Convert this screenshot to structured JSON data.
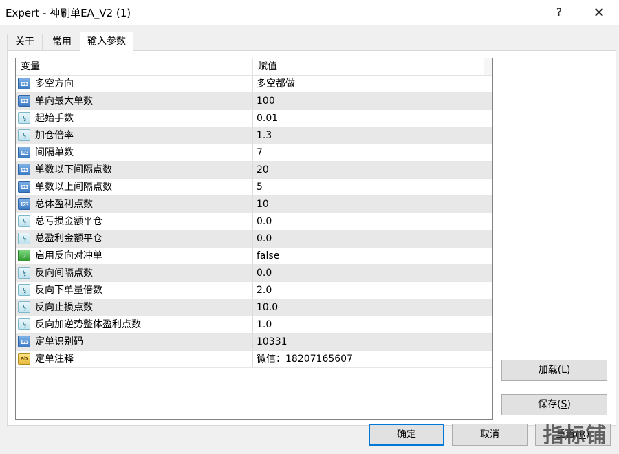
{
  "window": {
    "title": "Expert - 神刷单EA_V2 (1)",
    "help_label": "?",
    "close_label": "✕"
  },
  "tabs": [
    {
      "label": "关于",
      "active": false
    },
    {
      "label": "常用",
      "active": false
    },
    {
      "label": "输入参数",
      "active": true
    }
  ],
  "grid": {
    "columns": {
      "variable": "变量",
      "value": "赋值"
    },
    "rows": [
      {
        "icon": "int-icon",
        "name": "多空方向",
        "value": "多空都做"
      },
      {
        "icon": "int-icon",
        "name": "单向最大单数",
        "value": "100"
      },
      {
        "icon": "double-icon",
        "name": "起始手数",
        "value": "0.01"
      },
      {
        "icon": "double-icon",
        "name": "加仓倍率",
        "value": "1.3"
      },
      {
        "icon": "int-icon",
        "name": "间隔单数",
        "value": "7"
      },
      {
        "icon": "int-icon",
        "name": "单数以下间隔点数",
        "value": "20"
      },
      {
        "icon": "int-icon",
        "name": "单数以上间隔点数",
        "value": "5"
      },
      {
        "icon": "int-icon",
        "name": "总体盈利点数",
        "value": "10"
      },
      {
        "icon": "double-icon",
        "name": "总亏损金额平仓",
        "value": "0.0"
      },
      {
        "icon": "double-icon",
        "name": "总盈利金额平仓",
        "value": "0.0"
      },
      {
        "icon": "bool-icon",
        "name": "启用反向对冲单",
        "value": "false"
      },
      {
        "icon": "double-icon",
        "name": "反向间隔点数",
        "value": "0.0"
      },
      {
        "icon": "double-icon",
        "name": "反向下单量倍数",
        "value": "2.0"
      },
      {
        "icon": "double-icon",
        "name": "反向止损点数",
        "value": "10.0"
      },
      {
        "icon": "double-icon",
        "name": "反向加逆势整体盈利点数",
        "value": "1.0"
      },
      {
        "icon": "int-icon",
        "name": "定单识别码",
        "value": "10331"
      },
      {
        "icon": "string-icon",
        "name": "定单注释",
        "value": "微信：18207165607"
      }
    ]
  },
  "icon_glyphs": {
    "int": "123",
    "double": "½",
    "bool": "⁄",
    "string": "ab"
  },
  "buttons": {
    "load": {
      "text": "加载",
      "key": "L"
    },
    "save": {
      "text": "保存",
      "key": "S"
    },
    "ok": "确定",
    "cancel": "取消",
    "reset": {
      "text": "重置",
      "key": "R"
    }
  },
  "watermark": "指标铺"
}
